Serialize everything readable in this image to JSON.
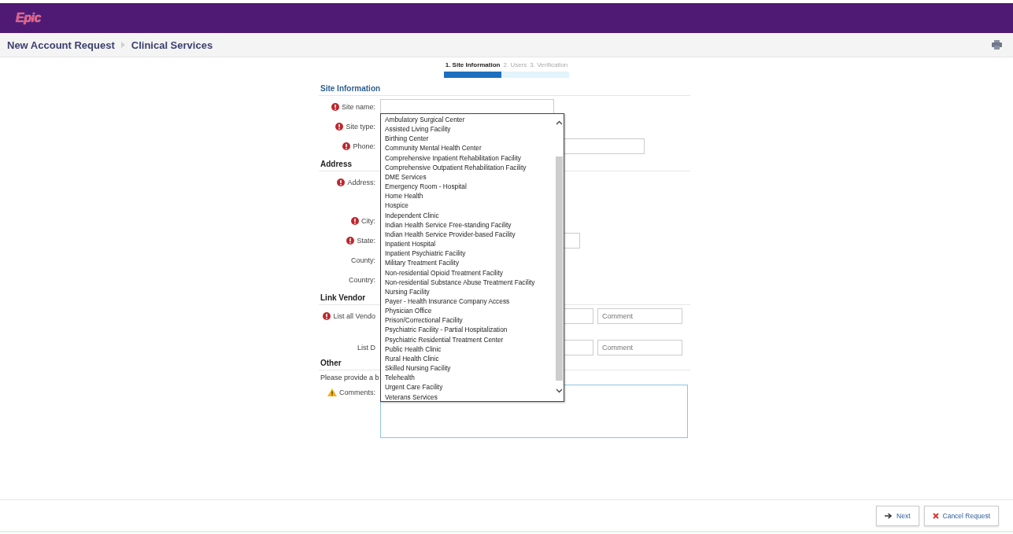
{
  "app": {
    "logo": "Epic"
  },
  "breadcrumb": [
    "New Account Request",
    "Clinical Services"
  ],
  "steps": [
    {
      "label": "1. Site Information",
      "selected": true
    },
    {
      "label": "2. Users",
      "selected": false
    },
    {
      "label": "3. Verification",
      "selected": false
    }
  ],
  "sections": [
    {
      "title": "Site Information",
      "rows": [
        {
          "label": "Site name:",
          "required": true,
          "field": {
            "kind": "text"
          }
        },
        {
          "label": "Site type:",
          "required": true,
          "field": {
            "kind": "dropdown",
            "options": [
              "Ambulatory Surgical Center",
              "Assisted Living Facility",
              "Birthing Center",
              "Community Mental Health Center",
              "Comprehensive Inpatient Rehabilitation Facility",
              "Comprehensive Outpatient Rehabilitation Facility",
              "DME Services",
              "Emergency Room - Hospital",
              "Home Health",
              "Hospice",
              "Independent Clinic",
              "Indian Health Service Free-standing Facility",
              "Indian Health Service Provider-based Facility",
              "Inpatient Hospital",
              "Inpatient Psychiatric Facility",
              "Military Treatment Facility",
              "Non-residential Opioid Treatment Facility",
              "Non-residential Substance Abuse Treatment Facility",
              "Nursing Facility",
              "Payer - Health Insurance Company Access",
              "Physician Office",
              "Prison/Correctional Facility",
              "Psychiatric Facility - Partial Hospitalization",
              "Psychiatric Residential Treatment Center",
              "Public Health Clinic",
              "Rural Health Clinic",
              "Skilled Nursing Facility",
              "Telehealth",
              "Urgent Care Facility",
              "Veterans Services"
            ]
          }
        },
        {
          "label": "Phone:",
          "required": true,
          "field": {
            "kind": "phone"
          }
        }
      ]
    },
    {
      "title": "Address",
      "rows": [
        {
          "label": "Address:",
          "required": true,
          "field": {
            "kind": "multiline"
          }
        },
        {
          "label": "City:",
          "required": true
        },
        {
          "label": "State:",
          "required": true,
          "field": {
            "kind": "state"
          }
        },
        {
          "label": "County:",
          "required": false
        },
        {
          "label": "Country:",
          "required": false
        }
      ]
    },
    {
      "title": "Link Vendor",
      "rows": [
        {
          "label": "List all Vendo",
          "required": true,
          "field": {
            "kind": "vendor",
            "placeholder": "Comment"
          }
        },
        {
          "label": "List D",
          "required": false,
          "field": {
            "kind": "vendor",
            "placeholder": "Comment"
          }
        }
      ]
    },
    {
      "title": "Other",
      "rows": [
        {
          "note": "Please provide a b"
        },
        {
          "label": "Comments:",
          "required": false,
          "warning": true,
          "field": {
            "kind": "textarea"
          }
        }
      ]
    }
  ],
  "buttons": [
    {
      "label": "Next",
      "kind": "next"
    },
    {
      "label": "Cancel Request",
      "kind": "cancel"
    }
  ]
}
